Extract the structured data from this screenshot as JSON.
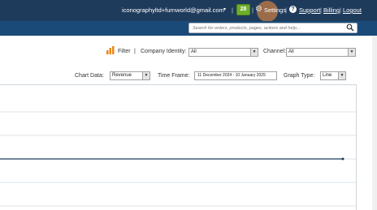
{
  "header": {
    "email": "iconographyltd+furnworld@gmail.com",
    "email_caret": "▾",
    "notifications_count": "28",
    "settings_label": "Settings",
    "help_label": "?",
    "support_label": "Support",
    "billing_label": "Billing",
    "logout_label": "Logout",
    "separator": "|"
  },
  "search": {
    "placeholder": "Search for orders, products, pages, actions and help..."
  },
  "filter_bar": {
    "filter_label": "Filter",
    "separator": "|",
    "company_identity_label": "Company Identity:",
    "company_identity_value": "All",
    "channel_label": "Channel:",
    "channel_value": "All"
  },
  "chart_controls": {
    "chart_data_label": "Chart Data:",
    "chart_data_value": "Revenue",
    "time_frame_label": "Time Frame:",
    "time_frame_value": "11 December 2024 - 10 January 2025",
    "graph_type_label": "Graph Type:",
    "graph_type_value": "Line"
  },
  "colors": {
    "topbar": "#1f3b5c",
    "search_row": "#1a4a78",
    "badge": "#6fae2a",
    "line": "#1f3b5c"
  },
  "chart_data": {
    "type": "line",
    "series": [
      {
        "values": [
          0,
          0
        ]
      }
    ],
    "grid": true
  }
}
